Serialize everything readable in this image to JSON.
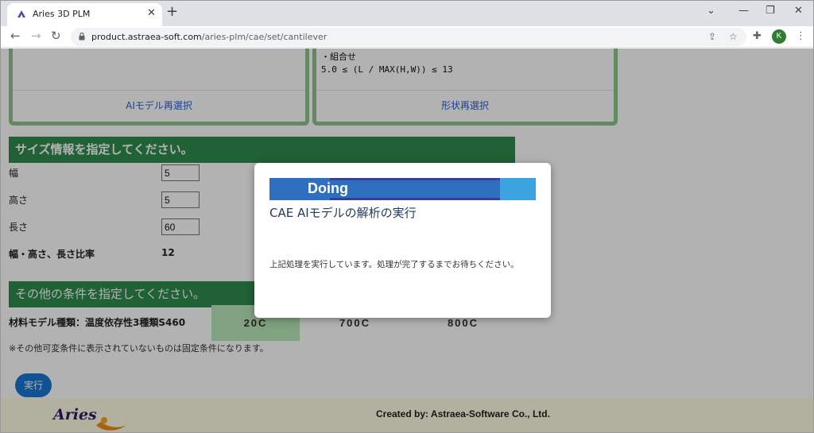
{
  "browser": {
    "tab_title": "Aries 3D PLM",
    "tab_close": "✕",
    "new_tab": "+",
    "url_host": "product.astraea-soft.com",
    "url_path": "/aries-plm/cae/set/cantilever",
    "profile_initial": "K",
    "icons": [
      "back-icon",
      "forward-icon",
      "reload-icon",
      "lock-icon",
      "share-icon",
      "star-icon",
      "extensions-icon",
      "menu-icon"
    ]
  },
  "cards": {
    "left_link": "AIモデル再選択",
    "right_condition_title": "・組合せ",
    "right_condition_formula": "5.0 ≤ (L / MAX(H,W)) ≤ 13",
    "right_link": "形状再選択"
  },
  "size_section": {
    "title": "サイズ情報を指定してください。",
    "rows": [
      {
        "label": "幅",
        "value": "5"
      },
      {
        "label": "高さ",
        "value": "5"
      },
      {
        "label": "長さ",
        "value": "60"
      }
    ],
    "ratio_label": "幅・高さ、長さ比率",
    "ratio_value": "12"
  },
  "other_section": {
    "title": "その他の条件を指定してください。",
    "material_label": "材料モデル種類：温度依存性3種類S460",
    "temperatures": [
      "20C",
      "700C",
      "800C"
    ],
    "selected_temperature": "20C",
    "note": "※その他可変条件に表示されていないものは固定条件になります。",
    "run_button": "実行"
  },
  "footer": {
    "logo_text": "Aries",
    "credit": "Created by: Astraea-Software Co., Ltd."
  },
  "modal": {
    "status": "Doing",
    "title": "CAE AIモデルの解析の実行",
    "message": "上記処理を実行しています。処理が完了するまでお待ちください。"
  },
  "colors": {
    "section_green": "#2e8b4e",
    "card_border": "#8fc48f",
    "link_blue": "#2962d4",
    "run_button": "#1976d2",
    "progress_dark": "#2f6fbf",
    "progress_light": "#3aa3e0"
  }
}
